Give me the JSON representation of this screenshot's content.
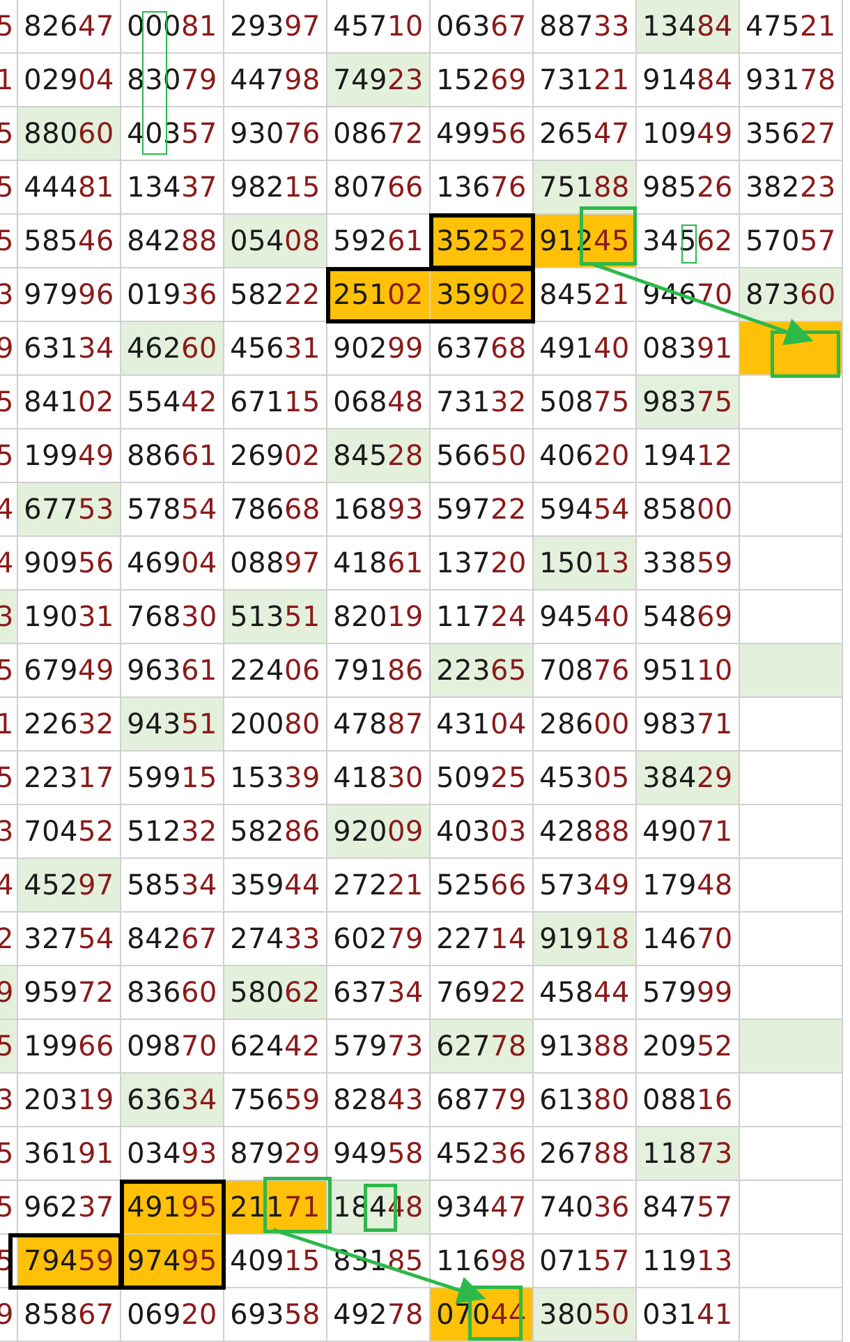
{
  "edge_digits": [
    "5",
    "1",
    "5",
    "5",
    "5",
    "3",
    "9",
    "5",
    "5",
    "4",
    "4",
    "3",
    "5",
    "1",
    "5",
    "3",
    "4",
    "2",
    "9",
    "5",
    "3",
    "5",
    "5",
    "5",
    "9"
  ],
  "grid": [
    [
      "82647",
      "00081",
      "29397",
      "45710",
      "06367",
      "88733",
      "13484",
      "47521"
    ],
    [
      "02904",
      "83079",
      "44798",
      "74923",
      "15269",
      "73121",
      "91484",
      "93178"
    ],
    [
      "88060",
      "40357",
      "93076",
      "08672",
      "49956",
      "26547",
      "10949",
      "35627"
    ],
    [
      "44481",
      "13437",
      "98215",
      "80766",
      "13676",
      "75188",
      "98526",
      "38223"
    ],
    [
      "58546",
      "84288",
      "05408",
      "59261",
      "35252",
      "91245",
      "34562",
      "57057"
    ],
    [
      "97996",
      "01936",
      "58222",
      "25102",
      "35902",
      "84521",
      "94670",
      "87360"
    ],
    [
      "63134",
      "46260",
      "45631",
      "90299",
      "63768",
      "49140",
      "08391",
      ""
    ],
    [
      "84102",
      "55442",
      "67115",
      "06848",
      "73132",
      "50875",
      "98375",
      ""
    ],
    [
      "19949",
      "88661",
      "26902",
      "84528",
      "56650",
      "40620",
      "19412",
      ""
    ],
    [
      "67753",
      "57854",
      "78668",
      "16893",
      "59722",
      "59454",
      "85800",
      ""
    ],
    [
      "90956",
      "46904",
      "08897",
      "41861",
      "13720",
      "15013",
      "33859",
      ""
    ],
    [
      "19031",
      "76830",
      "51351",
      "82019",
      "11724",
      "94540",
      "54869",
      ""
    ],
    [
      "67949",
      "96361",
      "22406",
      "79186",
      "22365",
      "70876",
      "95110",
      ""
    ],
    [
      "22632",
      "94351",
      "20080",
      "47887",
      "43104",
      "28600",
      "98371",
      ""
    ],
    [
      "22317",
      "59915",
      "15339",
      "41830",
      "50925",
      "45305",
      "38429",
      ""
    ],
    [
      "70452",
      "51232",
      "58286",
      "92009",
      "40303",
      "42888",
      "49071",
      ""
    ],
    [
      "45297",
      "58534",
      "35944",
      "27221",
      "52566",
      "57349",
      "17948",
      ""
    ],
    [
      "32754",
      "84267",
      "27433",
      "60279",
      "22714",
      "91918",
      "14670",
      ""
    ],
    [
      "95972",
      "83660",
      "58062",
      "63734",
      "76922",
      "45844",
      "57999",
      ""
    ],
    [
      "19966",
      "09870",
      "62442",
      "57973",
      "62778",
      "91388",
      "20952",
      ""
    ],
    [
      "20319",
      "63634",
      "75659",
      "82843",
      "68779",
      "61380",
      "08816",
      ""
    ],
    [
      "36191",
      "03493",
      "87929",
      "94958",
      "45236",
      "26788",
      "11873",
      ""
    ],
    [
      "96237",
      "49195",
      "21171",
      "18448",
      "93447",
      "74036",
      "84757",
      ""
    ],
    [
      "79459",
      "97495",
      "40915",
      "83185",
      "11698",
      "07157",
      "11913",
      ""
    ],
    [
      "85867",
      "06920",
      "69358",
      "49278",
      "07044",
      "38050",
      "03141",
      ""
    ]
  ],
  "highlights": {
    "green_cells": [
      [
        0,
        6
      ],
      [
        1,
        3
      ],
      [
        2,
        0
      ],
      [
        3,
        5
      ],
      [
        4,
        2
      ],
      [
        5,
        7
      ],
      [
        6,
        1
      ],
      [
        7,
        6
      ],
      [
        8,
        3
      ],
      [
        9,
        0
      ],
      [
        10,
        5
      ],
      [
        11,
        2
      ],
      [
        12,
        4
      ],
      [
        12,
        7
      ],
      [
        13,
        1
      ],
      [
        14,
        6
      ],
      [
        15,
        3
      ],
      [
        16,
        0
      ],
      [
        17,
        5
      ],
      [
        18,
        2
      ],
      [
        19,
        4
      ],
      [
        19,
        7
      ],
      [
        20,
        1
      ],
      [
        21,
        6
      ],
      [
        22,
        3
      ],
      [
        24,
        5
      ]
    ],
    "orange_cells": [
      [
        4,
        4
      ],
      [
        4,
        5
      ],
      [
        5,
        3
      ],
      [
        5,
        4
      ],
      [
        6,
        7
      ],
      [
        22,
        1
      ],
      [
        22,
        2
      ],
      [
        23,
        0
      ],
      [
        23,
        1
      ],
      [
        24,
        4
      ]
    ],
    "green_edge_rows": [
      11,
      18,
      19
    ]
  },
  "colors": {
    "digit_dark": "#1a1a1a",
    "digit_red": "#8b1a1a",
    "green_fill": "#e3f0dc",
    "orange_fill": "#ffc107",
    "green_marker": "#2db84a",
    "grid_line": "#d0d0d0"
  }
}
